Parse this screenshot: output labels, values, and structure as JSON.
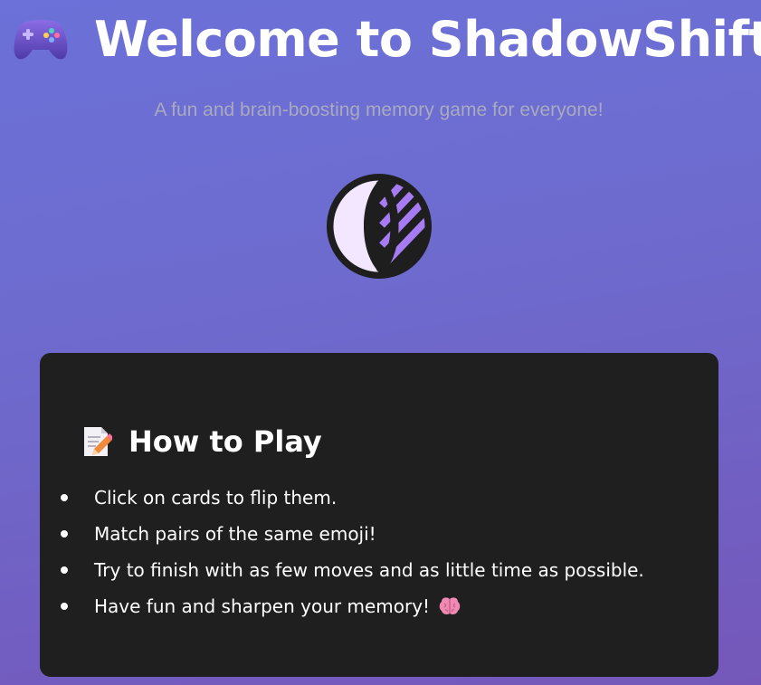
{
  "header": {
    "title": "Welcome to ShadowShift!",
    "title_icon": "game-controller-icon",
    "subtitle": "A fun and brain-boosting memory game for everyone!",
    "logo_icon": "shadowshift-moon-logo"
  },
  "how_to_play": {
    "heading": "How to Play",
    "heading_icon": "memo-pencil-icon",
    "rules": [
      "Click on cards to flip them.",
      "Match pairs of the same emoji!",
      "Try to finish with as few moves and as little time as possible.",
      "Have fun and sharpen your memory!"
    ],
    "last_rule_icon": "brain-icon"
  },
  "colors": {
    "background_start": "#6b71d8",
    "background_end": "#7457b9",
    "card_background": "#1f1f1f",
    "logo_dark": "#1e1e1e",
    "logo_light": "#f3e6ff",
    "logo_accent": "#a77bf3"
  }
}
